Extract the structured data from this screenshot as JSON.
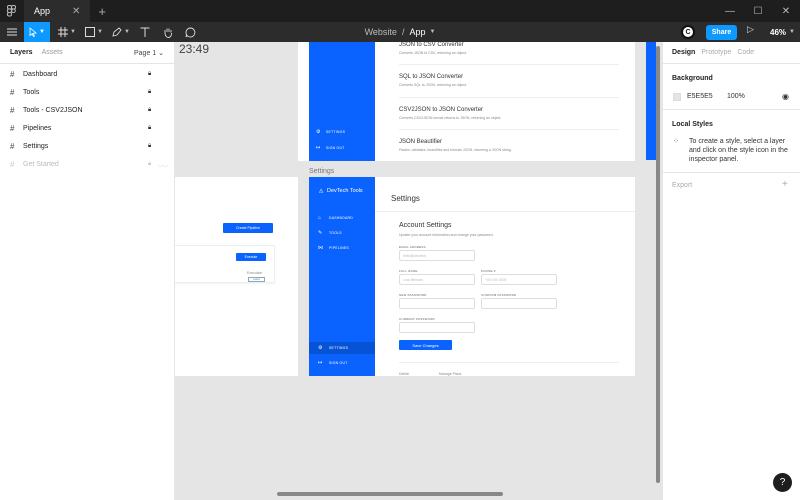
{
  "titlebar": {
    "tab_label": "App",
    "close": "✕",
    "new_tab": "+",
    "minimize": "—",
    "maximize": "☐",
    "close_window": "✕"
  },
  "toolbar": {
    "breadcrumb_project": "Website",
    "breadcrumb_sep": "/",
    "breadcrumb_file": "App",
    "avatar_initial": "C",
    "share_label": "Share",
    "zoom": "46%"
  },
  "left_panel": {
    "tab_layers": "Layers",
    "tab_assets": "Assets",
    "page": "Page 1 ⌄",
    "layers": [
      {
        "name": "Dashboard"
      },
      {
        "name": "Tools"
      },
      {
        "name": "Tools - CSV2JSON"
      },
      {
        "name": "Pipelines"
      },
      {
        "name": "Settings"
      },
      {
        "name": "Get Started"
      }
    ]
  },
  "canvas": {
    "clock": "23:49",
    "converters": [
      {
        "title": "JSON to CSV Converter",
        "desc": "Converts JSON to CSV, returning an object."
      },
      {
        "title": "SQL to JSON Converter",
        "desc": "Converts SQL to JSON, returning an object."
      },
      {
        "title": "CSV2JSON to JSON Converter",
        "desc": "Converts CSV2JSON format returns to JSON, returning an object."
      },
      {
        "title": "JSON Beautifier",
        "desc": "Pastes, validates, beautifies and formats JSON, returning a JSON string."
      }
    ],
    "top_nav": {
      "settings": "SETTINGS",
      "signout": "SIGN OUT"
    },
    "settings_frame_label": "Settings",
    "brand": "DevTech Tools",
    "nav": {
      "dashboard": "DASHBOARD",
      "tools": "TOOLS",
      "pipelines": "PIPELINES",
      "settings": "SETTINGS",
      "signout": "SIGN OUT"
    },
    "page_title": "Settings",
    "account_title": "Account Settings",
    "account_sub": "Update your account information and change your password.",
    "fields": {
      "email_label": "EMAIL ADDRESS",
      "email_ph": "hello@devtech",
      "fullname_label": "FULL NAME",
      "fullname_ph": "Lina Bernard",
      "phone_label": "PHONE #",
      "phone_ph": "+00 000 0000",
      "newpw_label": "NEW PASSWORD",
      "confirmpw_label": "CONFIRM PASSWORD",
      "currentpw_label": "CURRENT PASSWORD"
    },
    "save_label": "Save Changes",
    "create_pipeline": "Create Pipeline",
    "execute": "Execute",
    "exec_meta1": "Execution",
    "exec_meta2": "Latest",
    "bottom_left": "Delete",
    "bottom_right": "Manage Plans"
  },
  "right_panel": {
    "tab_design": "Design",
    "tab_prototype": "Prototype",
    "tab_code": "Code",
    "background_label": "Background",
    "bg_hex": "E5E5E5",
    "bg_opacity": "100%",
    "local_styles_label": "Local Styles",
    "local_styles_text": "To create a style, select a layer and click on the style icon in the inspector panel.",
    "export_label": "Export"
  },
  "colors": {
    "accent": "#0d99ff",
    "brand_blue": "#0b63ff",
    "canvas_bg": "#e5e5e5"
  }
}
